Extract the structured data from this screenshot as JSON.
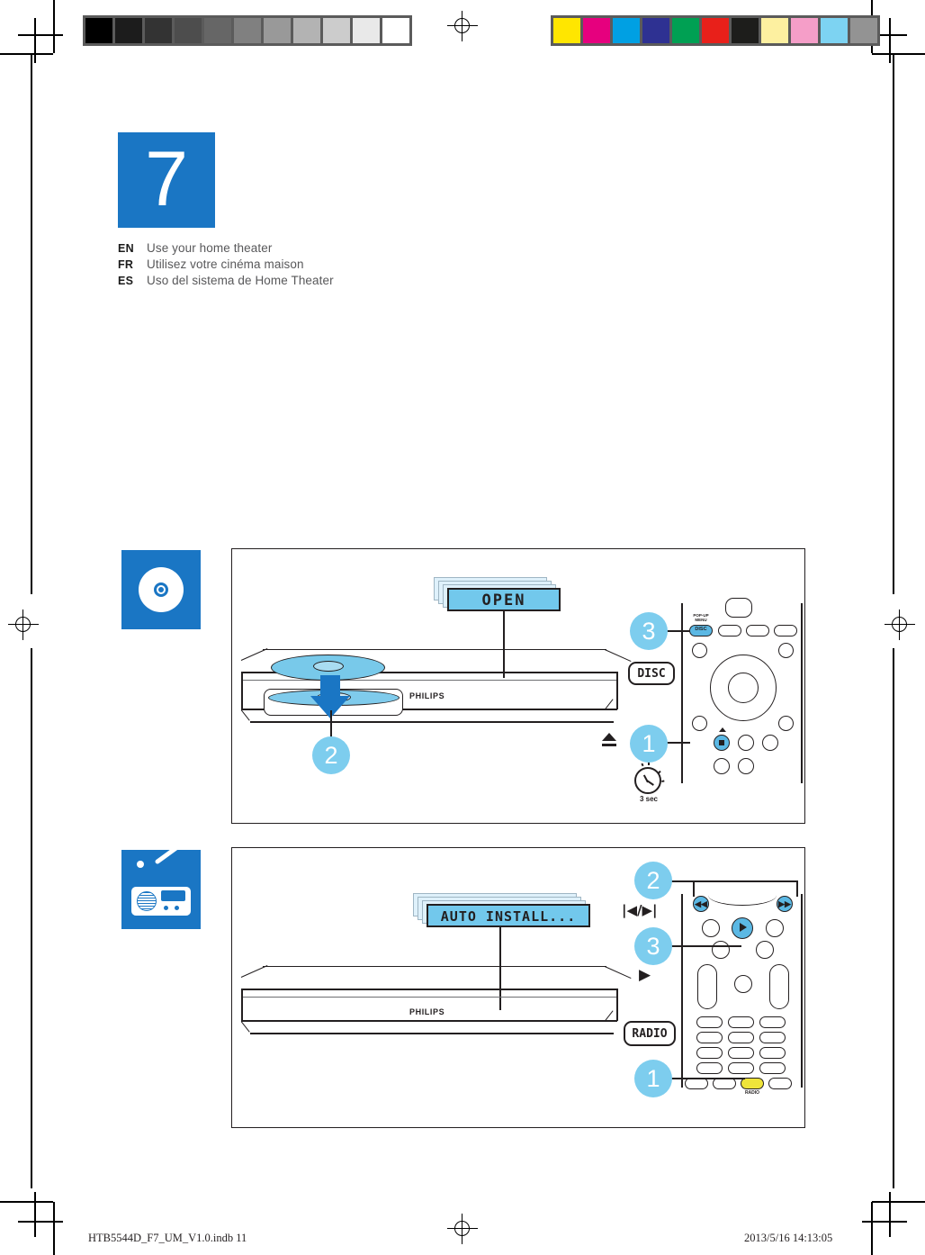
{
  "document": {
    "chapter_number": "7",
    "languages": [
      {
        "code": "EN",
        "text": "Use your home theater"
      },
      {
        "code": "FR",
        "text": "Utilisez votre cinéma maison"
      },
      {
        "code": "ES",
        "text": "Uso del sistema de Home Theater"
      }
    ],
    "footer": {
      "filename": "HTB5544D_F7_UM_V1.0.indb   11",
      "timestamp": "2013/5/16   14:13:05"
    }
  },
  "calibration": {
    "gray_bar": [
      "#000000",
      "#1c1c1c",
      "#333333",
      "#4d4d4d",
      "#666666",
      "#808080",
      "#999999",
      "#b3b3b3",
      "#cccccc",
      "#e9e9e9",
      "#ffffff"
    ],
    "color_bar": [
      "#ffe600",
      "#e6007e",
      "#00a0e3",
      "#2e3192",
      "#00a053",
      "#e8201a",
      "#1d1d1b",
      "#fdf0a0",
      "#f59ec8",
      "#7dd3f2",
      "#939393"
    ]
  },
  "colors": {
    "brand_blue": "#1a76c4",
    "step_blue": "#7dcdee",
    "lcd_blue": "#72c8ec",
    "highlight_key": "#5bb8e4",
    "radio_key_yellow": "#efe43a",
    "ink": "#231f20"
  },
  "panels": [
    {
      "id": "disc-playback",
      "icon": "disc-icon",
      "display": {
        "text": "OPEN",
        "ghost_layers": 3
      },
      "device": {
        "brand": "PHILIPS",
        "action": "insert-disc"
      },
      "steps": [
        {
          "number": "1",
          "target": "stop-eject-button"
        },
        {
          "number": "2",
          "target": "disc-tray"
        },
        {
          "number": "3",
          "target": "disc-button"
        }
      ],
      "key_labels": [
        {
          "name": "disc-key",
          "text": "DISC"
        }
      ],
      "button_captions": [
        {
          "name": "pop-up-menu-caption",
          "line1": "POP-UP",
          "line2": "MENU"
        },
        {
          "name": "disc-key-caption",
          "text": "DISC"
        }
      ],
      "glyphs": [
        {
          "name": "eject-glyph",
          "symbol": "eject"
        }
      ],
      "timer": {
        "label": "3 sec"
      }
    },
    {
      "id": "radio-tuning",
      "icon": "radio-icon",
      "display": {
        "text": "AUTO INSTALL...",
        "ghost_layers": 3
      },
      "device": {
        "brand": "PHILIPS"
      },
      "steps": [
        {
          "number": "1",
          "target": "radio-source-button"
        },
        {
          "number": "2",
          "target": "prev-next-buttons"
        },
        {
          "number": "3",
          "target": "play-button"
        }
      ],
      "key_labels": [
        {
          "name": "radio-key",
          "text": "RADIO"
        }
      ],
      "button_captions": [
        {
          "name": "radio-key-caption",
          "text": "RADIO"
        }
      ],
      "glyphs": [
        {
          "name": "prev-next-glyph",
          "symbol": "|◀/▶|"
        },
        {
          "name": "play-glyph",
          "symbol": "▶"
        }
      ]
    }
  ]
}
